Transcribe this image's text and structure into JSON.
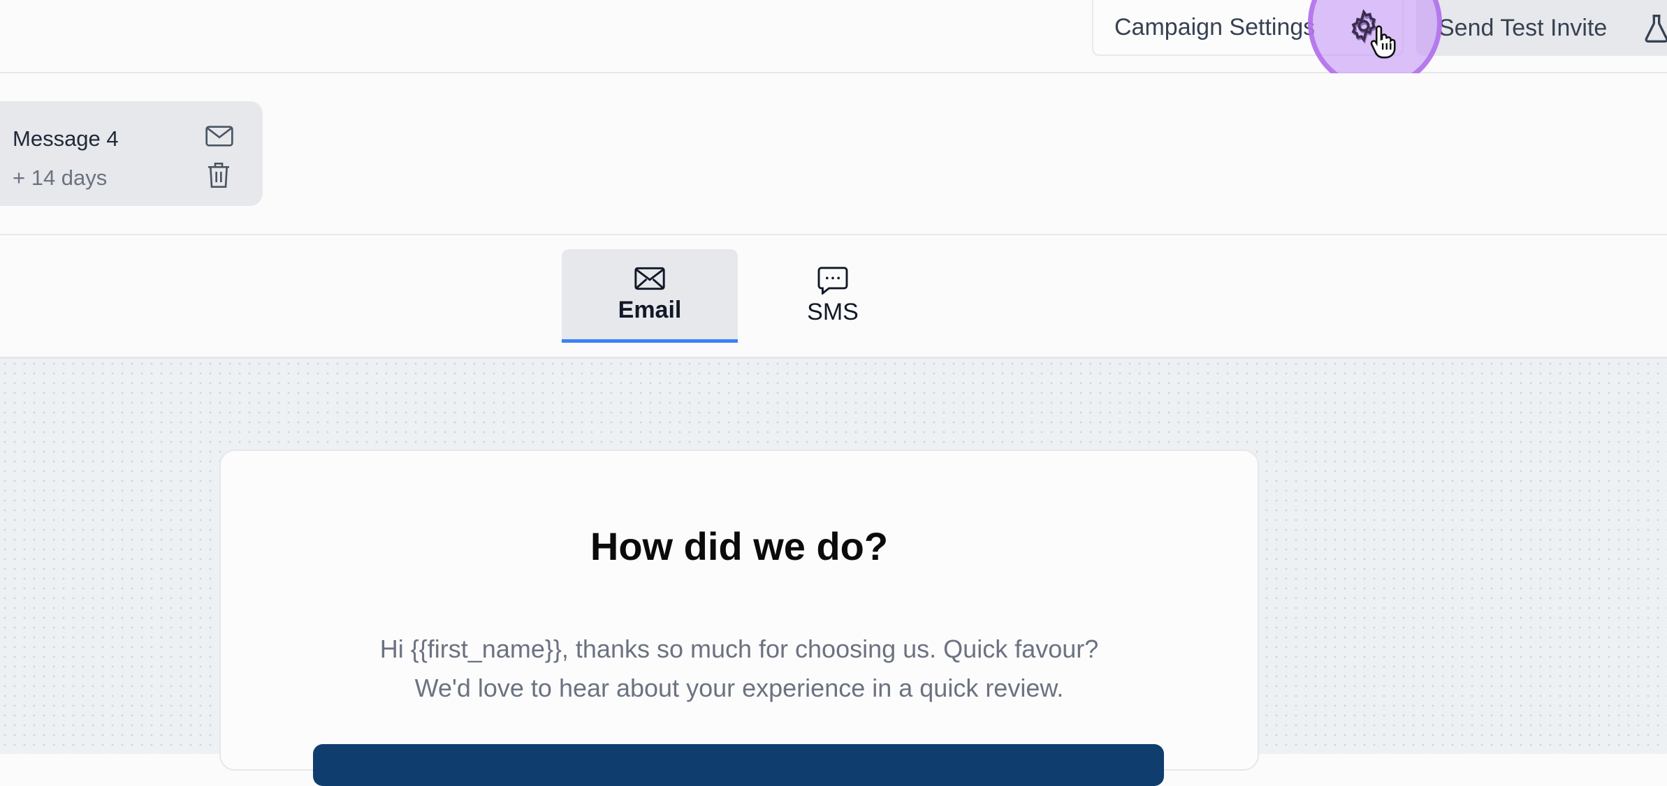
{
  "header": {
    "campaign_settings_label": "Campaign Settings",
    "send_test_invite_label": "Send Test Invite"
  },
  "message": {
    "title": "Message 4",
    "delay": "+ 14 days"
  },
  "tabs": [
    {
      "label": "Email",
      "icon": "envelope-icon",
      "active": true
    },
    {
      "label": "SMS",
      "icon": "chat-bubble-icon",
      "active": false
    }
  ],
  "email_preview": {
    "heading": "How did we do?",
    "body_line1": "Hi {{first_name}}, thanks so much for choosing us. Quick favour?",
    "body_line2": "We'd love to hear about your experience in a quick review."
  },
  "colors": {
    "accent": "#3b82f6",
    "cta_button": "#0f3e6e",
    "cursor_highlight": "#c599f5"
  }
}
